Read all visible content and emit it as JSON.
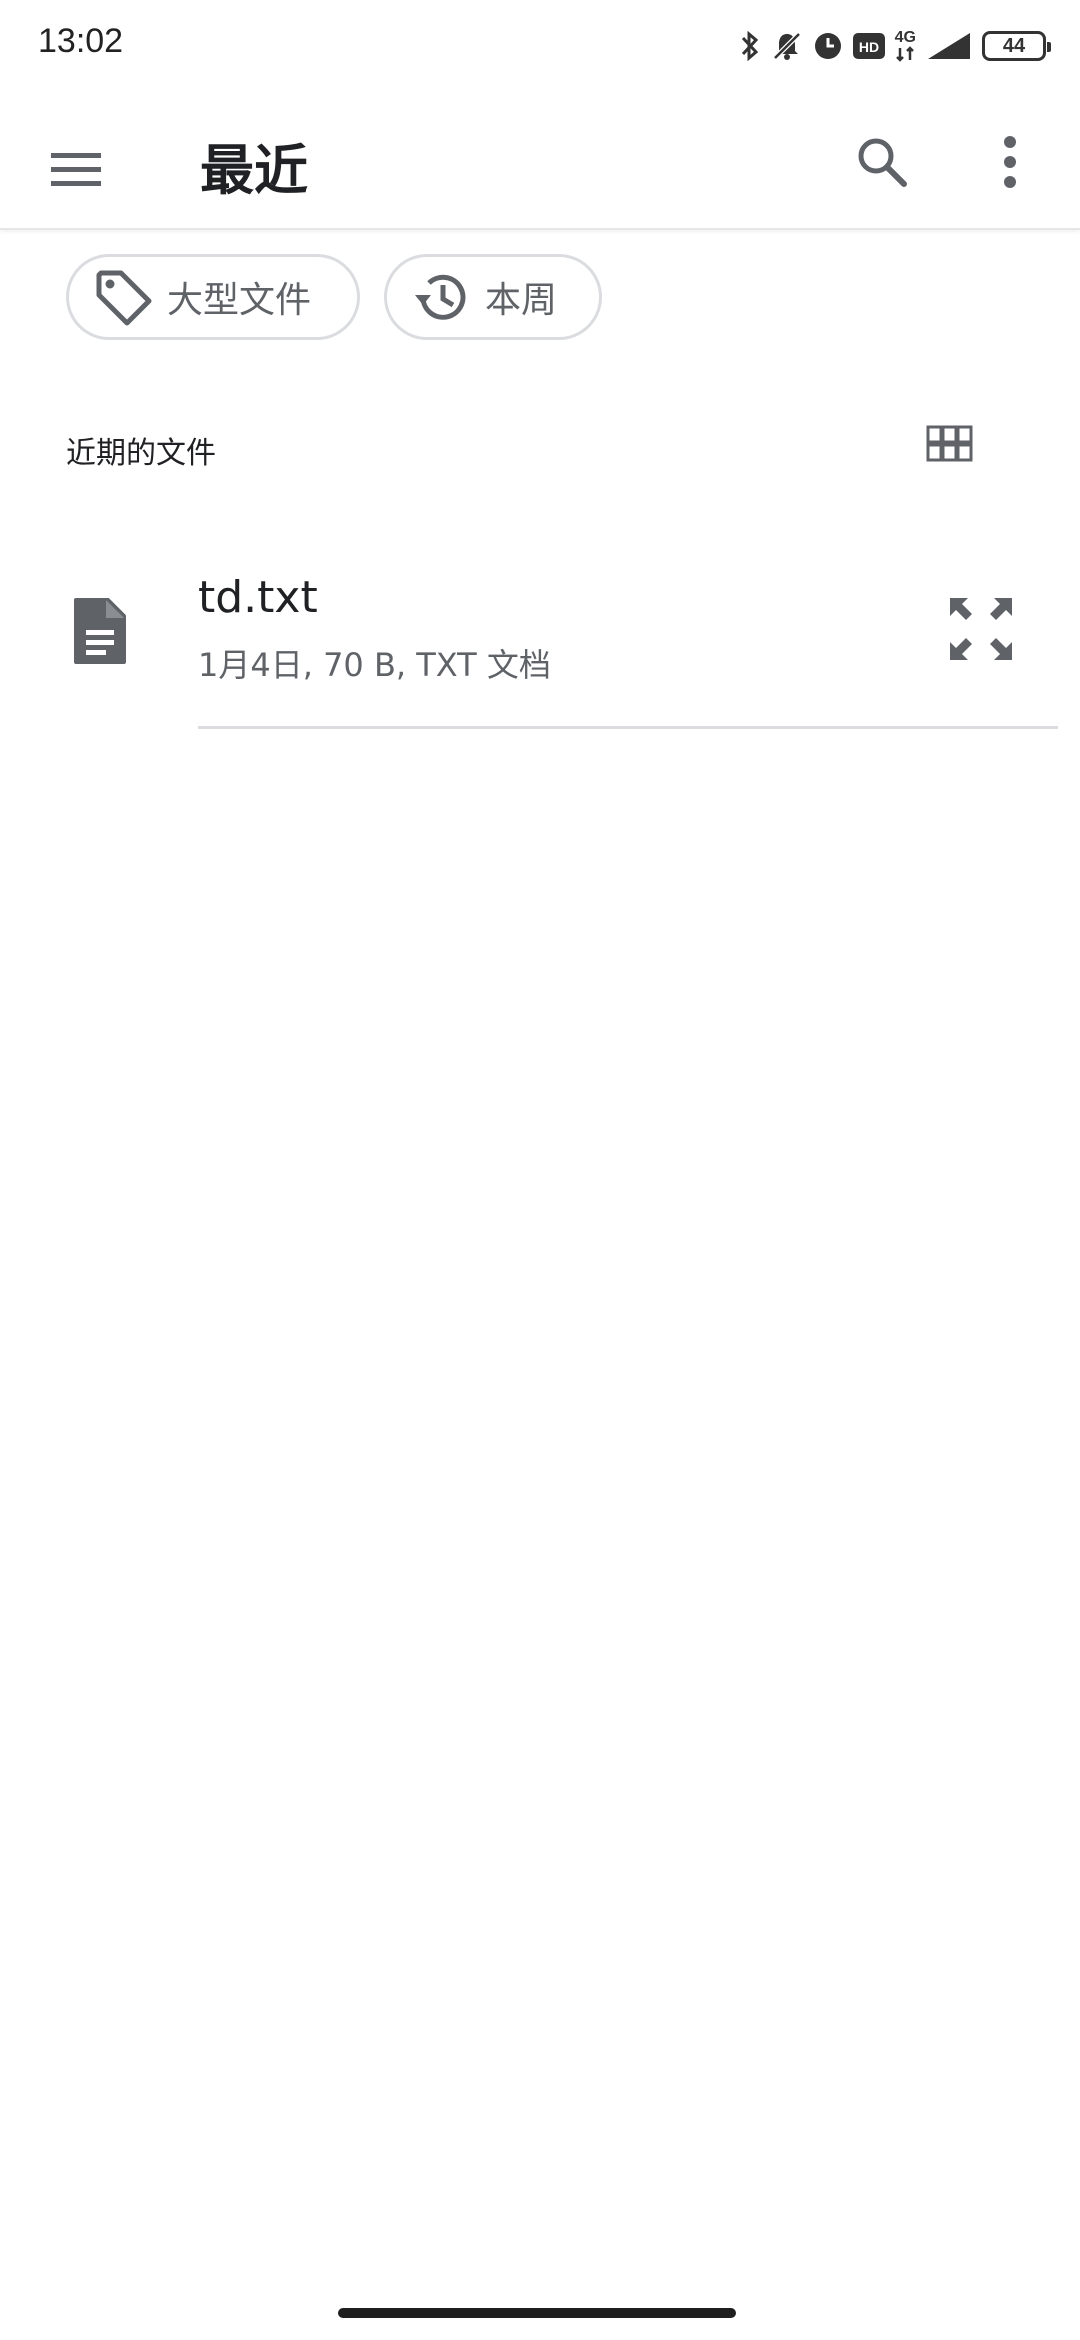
{
  "status_bar": {
    "time": "13:02",
    "network": "4G",
    "battery": "44",
    "icons": [
      "bluetooth-icon",
      "mute-bell-icon",
      "alarm-icon",
      "hd-icon",
      "signal-icon",
      "battery-icon"
    ]
  },
  "app_bar": {
    "title": "最近",
    "icons": [
      "menu-icon",
      "search-icon",
      "more-vert-icon"
    ]
  },
  "chips": [
    {
      "label": "大型文件",
      "icon": "tag-icon"
    },
    {
      "label": "本周",
      "icon": "history-icon"
    }
  ],
  "section": {
    "title": "近期的文件",
    "view_icon": "grid-view-icon"
  },
  "files": [
    {
      "name": "td.txt",
      "meta": "1月4日, 70 B, TXT 文档",
      "icon": "document-icon",
      "action_icon": "expand-icon"
    }
  ],
  "colors": {
    "icon_gray": "#5f6368",
    "text_primary": "#202124",
    "divider": "#dadce0"
  }
}
